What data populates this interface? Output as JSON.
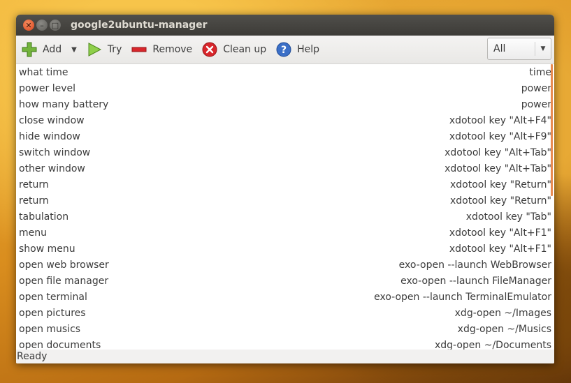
{
  "window": {
    "title": "google2ubuntu-manager"
  },
  "toolbar": {
    "add_label": "Add",
    "try_label": "Try",
    "remove_label": "Remove",
    "cleanup_label": "Clean up",
    "help_label": "Help",
    "filter": {
      "selected": "All"
    }
  },
  "commands": [
    {
      "phrase": "what time",
      "action": "time"
    },
    {
      "phrase": "power level",
      "action": "power"
    },
    {
      "phrase": "how many battery",
      "action": "power"
    },
    {
      "phrase": "close window",
      "action": "xdotool key \"Alt+F4\""
    },
    {
      "phrase": "hide window",
      "action": "xdotool key \"Alt+F9\""
    },
    {
      "phrase": "switch window",
      "action": "xdotool key \"Alt+Tab\""
    },
    {
      "phrase": "other window",
      "action": "xdotool key \"Alt+Tab\""
    },
    {
      "phrase": "return",
      "action": "xdotool key \"Return\""
    },
    {
      "phrase": "return",
      "action": "xdotool key \"Return\""
    },
    {
      "phrase": "tabulation",
      "action": "xdotool key \"Tab\""
    },
    {
      "phrase": "menu",
      "action": "xdotool key \"Alt+F1\""
    },
    {
      "phrase": "show menu",
      "action": "xdotool key \"Alt+F1\""
    },
    {
      "phrase": "open web browser",
      "action": "exo-open --launch WebBrowser"
    },
    {
      "phrase": "open file manager",
      "action": "exo-open --launch FileManager"
    },
    {
      "phrase": "open terminal",
      "action": "exo-open --launch TerminalEmulator"
    },
    {
      "phrase": "open pictures",
      "action": "xdg-open ~/Images"
    },
    {
      "phrase": "open musics",
      "action": "xdg-open ~/Musics"
    },
    {
      "phrase": "open documents",
      "action": "xdg-open ~/Documents"
    }
  ],
  "status": {
    "text": "Ready"
  },
  "colors": {
    "scrollbar": "#e98c52",
    "titlebar": "#3c3b37",
    "close_button": "#d9441d"
  }
}
